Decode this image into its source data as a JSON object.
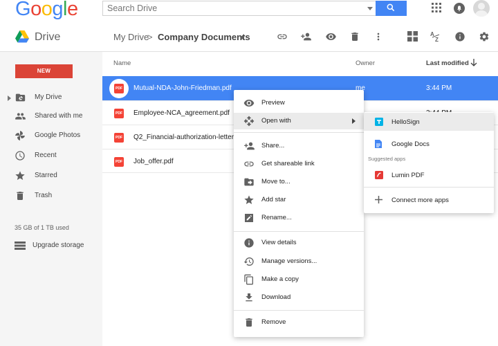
{
  "header": {
    "logo_letters": [
      {
        "ch": "G",
        "color": "#4285f4"
      },
      {
        "ch": "o",
        "color": "#ea4335"
      },
      {
        "ch": "o",
        "color": "#fbbc05"
      },
      {
        "ch": "g",
        "color": "#4285f4"
      },
      {
        "ch": "l",
        "color": "#34a853"
      },
      {
        "ch": "e",
        "color": "#ea4335"
      }
    ],
    "search_placeholder": "Search Drive",
    "apps_icon": "apps-grid-icon",
    "notifications_icon": "bell-icon"
  },
  "drivebar": {
    "title": "Drive",
    "breadcrumb_root": "My Drive",
    "breadcrumb_sep": ">",
    "breadcrumb_current": "Company Documents",
    "toolbar_icons": [
      "link-icon",
      "share-person-icon",
      "preview-eye-icon",
      "trash-icon",
      "more-vert-icon",
      "grid-view-icon",
      "sort-az-icon",
      "info-icon",
      "settings-icon"
    ]
  },
  "sidebar": {
    "new_label": "NEW",
    "items": [
      {
        "label": "My Drive",
        "icon": "drive-folder-icon"
      },
      {
        "label": "Shared with me",
        "icon": "people-icon"
      },
      {
        "label": "Google Photos",
        "icon": "photos-pinwheel-icon"
      },
      {
        "label": "Recent",
        "icon": "clock-icon"
      },
      {
        "label": "Starred",
        "icon": "star-icon"
      },
      {
        "label": "Trash",
        "icon": "trash-icon"
      }
    ],
    "storage": "35 GB of 1 TB used",
    "upgrade_label": "Upgrade storage"
  },
  "list": {
    "col_name": "Name",
    "col_owner": "Owner",
    "col_modified": "Last modified",
    "files": [
      {
        "name": "Mutual-NDA-John-Friedman.pdf",
        "owner": "me",
        "modified": "3:44 PM",
        "selected": true
      },
      {
        "name": "Employee-NCA_agreement.pdf",
        "owner": "",
        "modified": "3:44 PM",
        "selected": false
      },
      {
        "name": "Q2_Financial-authorization-letter.pdf",
        "owner": "",
        "modified": "",
        "selected": false
      },
      {
        "name": "Job_offer.pdf",
        "owner": "",
        "modified": "",
        "selected": false
      }
    ],
    "pdf_badge": "PDF"
  },
  "context_menu": {
    "items": [
      {
        "label": "Preview",
        "icon": "eye-icon"
      },
      {
        "label": "Open with",
        "icon": "open-with-move-icon",
        "has_sub": true
      },
      {
        "label": "Share...",
        "icon": "person-add-icon"
      },
      {
        "label": "Get shareable link",
        "icon": "link-icon"
      },
      {
        "label": "Move to...",
        "icon": "folder-move-icon"
      },
      {
        "label": "Add star",
        "icon": "star-icon"
      },
      {
        "label": "Rename...",
        "icon": "pencil-icon"
      },
      {
        "label": "View details",
        "icon": "info-icon"
      },
      {
        "label": "Manage versions...",
        "icon": "history-icon"
      },
      {
        "label": "Make a copy",
        "icon": "copy-icon"
      },
      {
        "label": "Download",
        "icon": "download-icon"
      },
      {
        "label": "Remove",
        "icon": "trash-icon"
      }
    ]
  },
  "submenu": {
    "items": [
      {
        "label": "HelloSign",
        "icon": "hellosign-icon",
        "color": "#00b3e6"
      },
      {
        "label": "Google Docs",
        "icon": "google-docs-icon",
        "color": "#4285f4"
      }
    ],
    "section_label": "Suggested apps",
    "suggested": [
      {
        "label": "Lumin PDF",
        "icon": "lumin-pdf-icon",
        "color": "#e53935"
      }
    ],
    "connect_label": "Connect more apps"
  },
  "colors": {
    "accent_blue": "#4285f4",
    "new_red": "#db4437",
    "pdf_red": "#f44336"
  }
}
